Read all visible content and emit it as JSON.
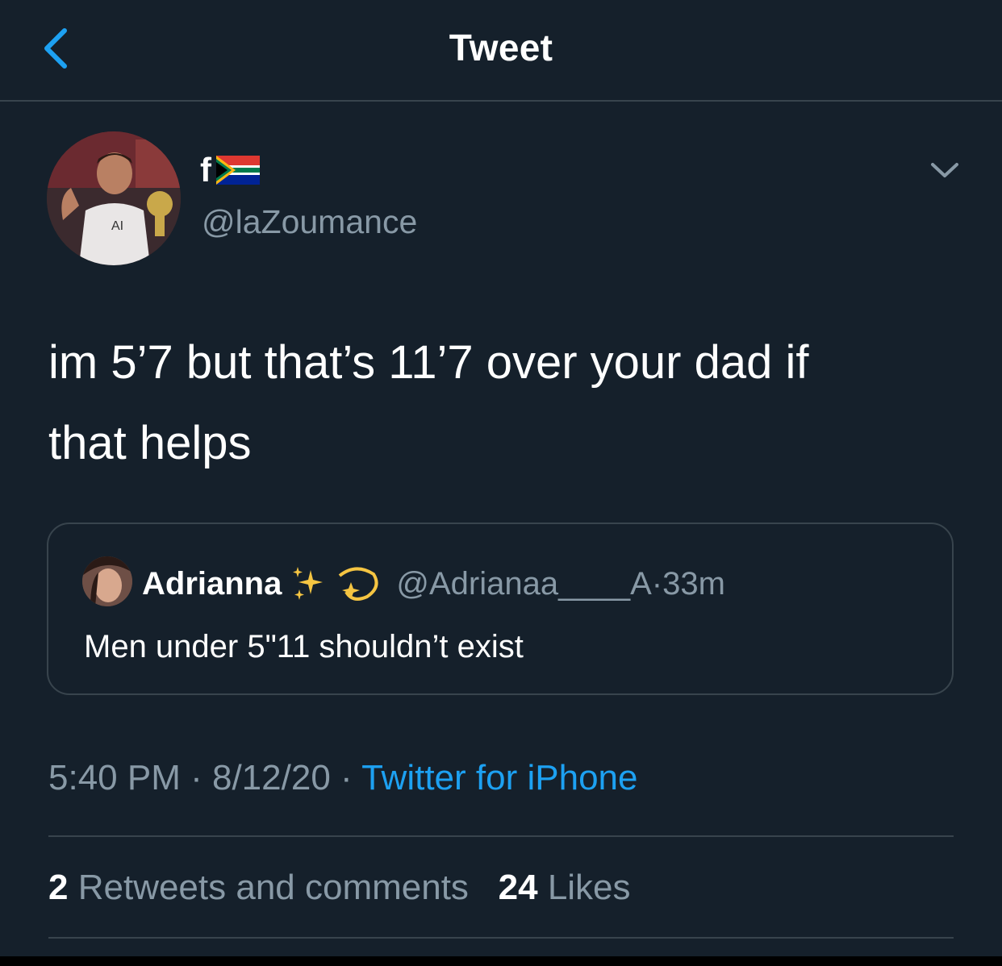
{
  "header": {
    "title": "Tweet"
  },
  "tweet": {
    "display_name": "f",
    "handle": "@laZoumance",
    "text_line1": "im 5’7 but that’s 11’7 over your dad if",
    "text_line2": "that helps"
  },
  "quoted_tweet": {
    "name": "Adrianna",
    "handle": "@Adrianaa____A",
    "time": "33m",
    "text": "Men under 5\"11 shouldn’t exist"
  },
  "meta": {
    "time": "5:40 PM",
    "date": "8/12/20",
    "source": "Twitter for iPhone",
    "separator": " · "
  },
  "stats": {
    "retweets_count": "2",
    "retweets_label": "Retweets and comments",
    "likes_count": "24",
    "likes_label": "Likes"
  },
  "colors": {
    "background": "#15202b",
    "secondary_text": "#8899a6",
    "accent": "#1da1f2",
    "divider": "#38444d"
  },
  "icons": {
    "back": "chevron-left-icon",
    "caret": "chevron-down-icon",
    "flag": "south-africa-flag-icon",
    "emoji1": "sparkles-icon",
    "emoji2": "dizzy-icon"
  }
}
